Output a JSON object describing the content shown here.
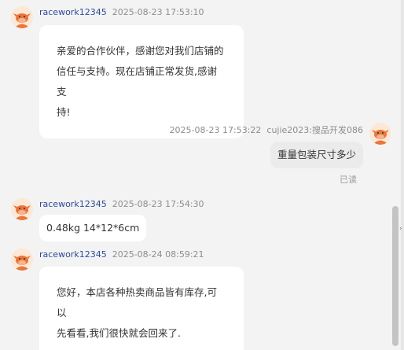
{
  "messages": [
    {
      "sender": "racework12345",
      "time": "2025-08-23 17:53:10",
      "lines": [
        "亲爱的合作伙伴，感谢您对我们店铺的",
        "信任与支持。现在店铺正常发货,感谢支",
        "持!"
      ]
    },
    {
      "sender": "cujie2023:搜品开发086",
      "time": "2025-08-23 17:53:22",
      "text": "重量包装尺寸多少",
      "status": "已读"
    },
    {
      "sender": "racework12345",
      "time": "2025-08-23 17:54:30",
      "text": "0.48kg 14*12*6cm"
    },
    {
      "sender": "racework12345",
      "time": "2025-08-24 08:59:21",
      "lines": [
        "您好，本店各种热卖商品皆有库存,可以",
        "先看看,我们很快就会回来了."
      ]
    }
  ],
  "avatar_icon": "cartoon-cow-avatar",
  "colors": {
    "background": "#f3f3f3",
    "sender_name": "#2d4a9a",
    "bubble_incoming": "#ffffff",
    "bubble_outgoing": "#ebebeb",
    "avatar_orange": "#e8763a"
  }
}
